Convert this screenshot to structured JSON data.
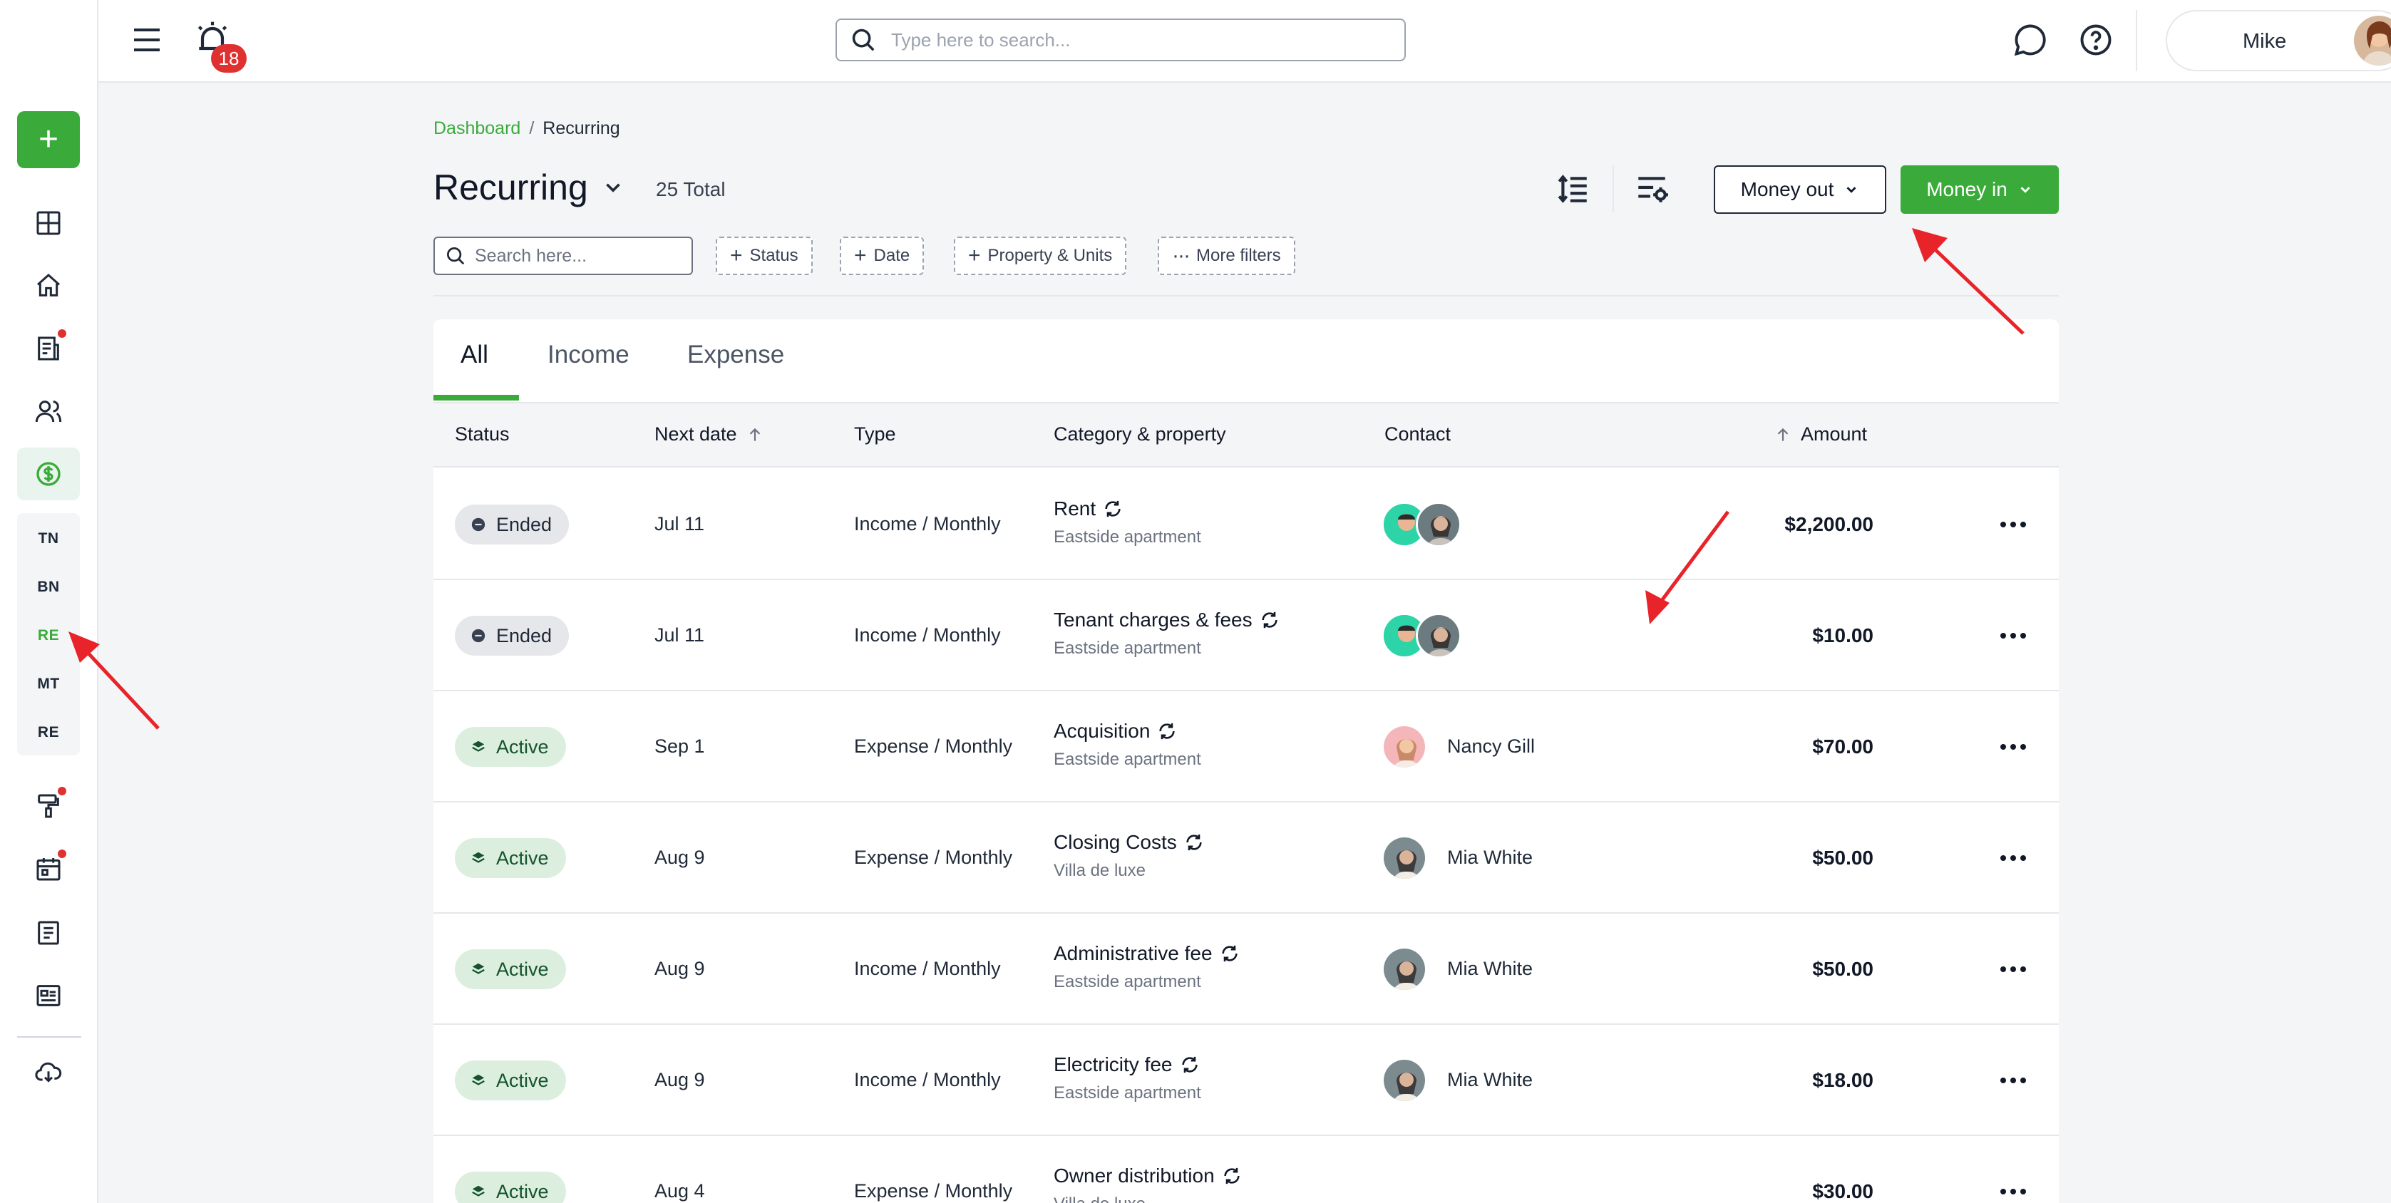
{
  "topbar": {
    "alert_count": "18",
    "search_placeholder": "Type here to search...",
    "user_name": "Mike"
  },
  "sidebar": {
    "sub_items": [
      "TN",
      "BN",
      "RE",
      "MT",
      "RE"
    ]
  },
  "breadcrumb": {
    "home": "Dashboard",
    "separator": "/",
    "current": "Recurring"
  },
  "header": {
    "title": "Recurring",
    "total": "25 Total",
    "money_out_label": "Money out",
    "money_in_label": "Money in"
  },
  "filters": {
    "search_placeholder": "Search here...",
    "status": "Status",
    "date": "Date",
    "property_units": "Property & Units",
    "more": "More filters"
  },
  "tabs": [
    "All",
    "Income",
    "Expense"
  ],
  "columns": {
    "status": "Status",
    "next_date": "Next date",
    "type": "Type",
    "category": "Category & property",
    "contact": "Contact",
    "amount": "Amount"
  },
  "rows": [
    {
      "status": "Ended",
      "date": "Jul 11",
      "type": "Income / Monthly",
      "category": "Rent",
      "property": "Eastside apartment",
      "contact": "",
      "amount": "$2,200.00"
    },
    {
      "status": "Ended",
      "date": "Jul 11",
      "type": "Income / Monthly",
      "category": "Tenant charges & fees",
      "property": "Eastside apartment",
      "contact": "",
      "amount": "$10.00"
    },
    {
      "status": "Active",
      "date": "Sep 1",
      "type": "Expense / Monthly",
      "category": "Acquisition",
      "property": "Eastside apartment",
      "contact": "Nancy Gill",
      "amount": "$70.00"
    },
    {
      "status": "Active",
      "date": "Aug 9",
      "type": "Expense / Monthly",
      "category": "Closing Costs",
      "property": "Villa de luxe",
      "contact": "Mia White",
      "amount": "$50.00"
    },
    {
      "status": "Active",
      "date": "Aug 9",
      "type": "Income / Monthly",
      "category": "Administrative fee",
      "property": "Eastside apartment",
      "contact": "Mia White",
      "amount": "$50.00"
    },
    {
      "status": "Active",
      "date": "Aug 9",
      "type": "Income / Monthly",
      "category": "Electricity fee",
      "property": "Eastside apartment",
      "contact": "Mia White",
      "amount": "$18.00"
    },
    {
      "status": "Active",
      "date": "Aug 4",
      "type": "Expense / Monthly",
      "category": "Owner distribution",
      "property": "Villa de luxe",
      "contact": "",
      "amount": "$30.00"
    }
  ],
  "colors": {
    "brand_green": "#3aab3a",
    "annotation_red": "#e8232a",
    "alert_red": "#e03131"
  }
}
